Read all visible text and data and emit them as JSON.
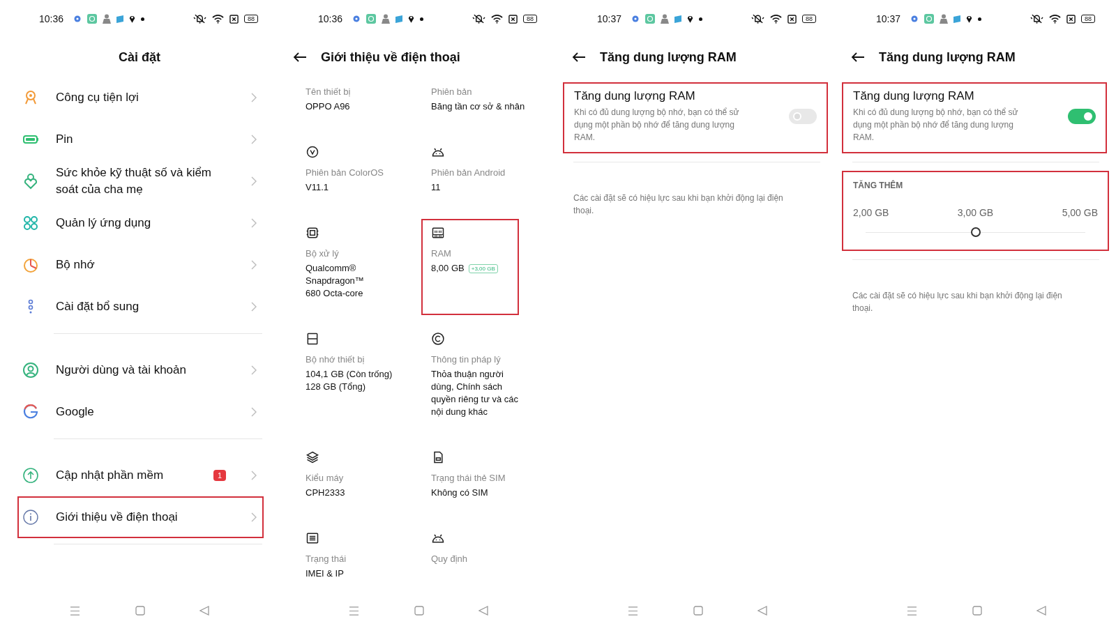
{
  "screens": [
    {
      "kind": "settings",
      "status": {
        "time": "10:36",
        "battery": "88"
      },
      "title": "Cài đặt",
      "groups": [
        [
          {
            "label": "Công cụ tiện lợi",
            "highlighted": false
          },
          {
            "label": "Pin",
            "highlighted": false
          },
          {
            "label": "Sức khỏe kỹ thuật số và kiểm soát của cha mẹ",
            "highlighted": false
          },
          {
            "label": "Quản lý ứng dụng",
            "highlighted": false
          },
          {
            "label": "Bộ nhớ",
            "highlighted": false
          },
          {
            "label": "Cài đặt bổ sung",
            "highlighted": false
          }
        ],
        [
          {
            "label": "Người dùng và tài khoản",
            "highlighted": false
          },
          {
            "label": "Google",
            "highlighted": false
          }
        ],
        [
          {
            "label": "Cập nhật phần mềm",
            "badge": "1",
            "highlighted": false
          },
          {
            "label": "Giới thiệu về điện thoại",
            "highlighted": true
          }
        ]
      ]
    },
    {
      "kind": "about",
      "status": {
        "time": "10:36",
        "battery": "88"
      },
      "title": "Giới thiệu về điện thoại",
      "cells": [
        {
          "label": "Tên thiết bị",
          "value": "OPPO A96",
          "highlighted": false
        },
        {
          "label": "Phiên bản",
          "value": "Băng tần cơ sở & nhân",
          "highlighted": false
        },
        {
          "label": "Phiên bản ColorOS",
          "value": "V11.1",
          "highlighted": false
        },
        {
          "label": "Phiên bản Android",
          "value": "11",
          "highlighted": false
        },
        {
          "label": "Bộ xử lý",
          "value": "Qualcomm®\nSnapdragon™\n680 Octa-core",
          "highlighted": false
        },
        {
          "label": "RAM",
          "value": "8,00 GB",
          "tag": "+3,00 GB",
          "highlighted": true
        },
        {
          "label": "Bộ nhớ thiết bị",
          "value": "104,1 GB (Còn trống)\n128 GB (Tổng)",
          "highlighted": false
        },
        {
          "label": "Thông tin pháp lý",
          "value": "Thỏa thuận người\ndùng, Chính sách\nquyền riêng tư và các\nnội dung khác",
          "highlighted": false
        },
        {
          "label": "Kiểu máy",
          "value": "CPH2333",
          "highlighted": false
        },
        {
          "label": "Trạng thái thẻ SIM",
          "value": "Không có SIM",
          "highlighted": false
        },
        {
          "label": "Trạng thái",
          "value": "IMEI & IP",
          "highlighted": false
        },
        {
          "label": "Quy định",
          "highlighted": false
        }
      ]
    },
    {
      "kind": "ram",
      "status": {
        "time": "10:37",
        "battery": "88"
      },
      "title": "Tăng dung lượng RAM",
      "card": {
        "title": "Tăng dung lượng RAM",
        "description": "Khi có đủ dung lượng bộ nhớ, bạn có thể sử dụng một phần bộ nhớ để tăng dung lượng RAM.",
        "on": false,
        "highlighted": true
      },
      "note": "Các cài đặt sẽ có hiệu lực sau khi bạn khởi động lại điện thoại."
    },
    {
      "kind": "ram",
      "status": {
        "time": "10:37",
        "battery": "88"
      },
      "title": "Tăng dung lượng RAM",
      "card": {
        "title": "Tăng dung lượng RAM",
        "description": "Khi có đủ dung lượng bộ nhớ, bạn có thể sử dụng một phần bộ nhớ để tăng dung lượng RAM.",
        "on": true,
        "highlighted": true
      },
      "extra": {
        "heading": "TĂNG THÊM",
        "options": [
          "2,00 GB",
          "3,00 GB",
          "5,00 GB"
        ],
        "level": 0.5,
        "highlighted": true
      },
      "note": "Các cài đặt sẽ có hiệu lực sau khi bạn khởi động lại điện thoại."
    }
  ]
}
